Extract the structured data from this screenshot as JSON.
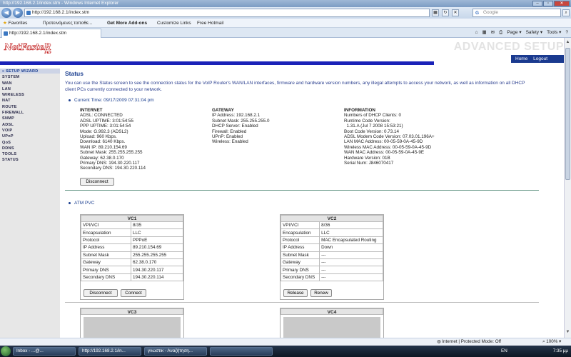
{
  "window": {
    "title": "http://192.168.2.1/index.stm - Windows Internet Explorer",
    "address": "http://192.168.2.1/index.stm",
    "search_placeholder": "Google",
    "tab_title": "http://192.168.2.1/index.stm"
  },
  "favorites_bar": {
    "favorites": "Favorites",
    "items": [
      "Προτεινόμενες τοποθε...",
      "Get More Add-ons",
      "Customize Links",
      "Free Hotmail"
    ]
  },
  "command_bar": {
    "page": "Page",
    "safety": "Safety",
    "tools": "Tools"
  },
  "header": {
    "logo": "NetFasteR",
    "logo_sub": "IAD",
    "advanced_setup": "ADVANCED SETUP",
    "home": "Home",
    "logout": "Logout"
  },
  "sidebar": {
    "items": [
      "» SETUP WIZARD",
      "SYSTEM",
      "WAN",
      "LAN",
      "WIRELESS",
      "NAT",
      "ROUTE",
      "FIREWALL",
      "SNMP",
      "ADSL",
      "VOIP",
      "UPnP",
      "QoS",
      "DDNS",
      "TOOLS",
      "STATUS"
    ]
  },
  "main": {
    "title": "Status",
    "intro": "You can use the Status screen to see the connection status for the VoIP Router's WAN/LAN interfaces, firmware and hardware version numbers, any illegal attempts to access your network, as well as information on all DHCP client PCs currently connected to your network.",
    "current_time": "Current Time: 09/17/2009 07:31:04 pm",
    "internet": {
      "header": "INTERNET",
      "lines": [
        "ADSL:  CONNECTED",
        "ADSL UPTIME:  3:01:54:55",
        "PPP UPTIME:  3:01:54:54",
        "Mode:  G.992.3 (ADSL2)",
        "Upload:  960 Kbps.",
        "Download:  6140 Kbps.",
        "WAN IP:  89.210.154.69",
        "Subnet Mask:  255.255.255.255",
        "Gateway:  62.38.0.170",
        "Primary DNS:  194.30.220.117",
        "Secondary DNS:  194.30.220.114"
      ]
    },
    "gateway": {
      "header": "GATEWAY",
      "lines": [
        "IP Address:  192.168.2.1",
        "Subnet Mask:  255.255.255.0",
        "DHCP Server:  Enabled",
        "Firewall:  Enabled",
        "UPnP:  Enabled",
        "Wireless:  Enabled"
      ]
    },
    "information": {
      "header": "INFORMATION",
      "lines": [
        "Numbers of DHCP Clients:  0",
        "Runtime Code Version:",
        "  1.31.A (Jul 7 2008 15:53:21)",
        "Boot Code Version:  0.73.14",
        "ADSL Modem Code Version:  07.03.01.196A+",
        "LAN MAC Address:  00-05-59-0A-45-9D",
        "Wireless MAC Address:  00-05-59-0A-45-9D",
        "WAN MAC Address:  00-05-59-0A-45-9E",
        "Hardware Version:  01B",
        "Serial Num:  J846070417"
      ]
    },
    "disconnect_label": "Disconnect",
    "atm_title": "ATM PVC",
    "vc1": {
      "title": "VC1",
      "rows": [
        [
          "VPI/VCI",
          "8/35"
        ],
        [
          "Encapsulation",
          "LLC"
        ],
        [
          "Protocol",
          "PPPoE"
        ],
        [
          "IP Address",
          "89.210.154.69"
        ],
        [
          "Subnet Mask",
          "255.255.255.255"
        ],
        [
          "Gateway",
          "62.38.0.170"
        ],
        [
          "Primary DNS",
          "194.30.220.117"
        ],
        [
          "Secondary DNS",
          "194.30.220.114"
        ]
      ],
      "btn1": "Disconnect",
      "btn2": "Connect"
    },
    "vc2": {
      "title": "VC2",
      "rows": [
        [
          "VPI/VCI",
          "8/36"
        ],
        [
          "Encapsulation",
          "LLC"
        ],
        [
          "Protocol",
          "MAC Encapsulated Routing"
        ],
        [
          "IP Address",
          "Down"
        ],
        [
          "Subnet Mask",
          "---"
        ],
        [
          "Gateway",
          "---"
        ],
        [
          "Primary DNS",
          "---"
        ],
        [
          "Secondary DNS",
          "---"
        ]
      ],
      "btn1": "Release",
      "btn2": "Renew"
    },
    "vc3": {
      "title": "VC3"
    },
    "vc4": {
      "title": "VC4"
    }
  },
  "statusbar": {
    "zone": "Internet | Protected Mode: Off",
    "zoom": "100%"
  },
  "taskbar": {
    "tasks": [
      "Inbox - ...@...",
      "http://192.168.2.1/in...",
      "γνωστικ - Αναζήτηση...",
      ""
    ],
    "lang": "EN",
    "clock": "7:35 μμ"
  }
}
